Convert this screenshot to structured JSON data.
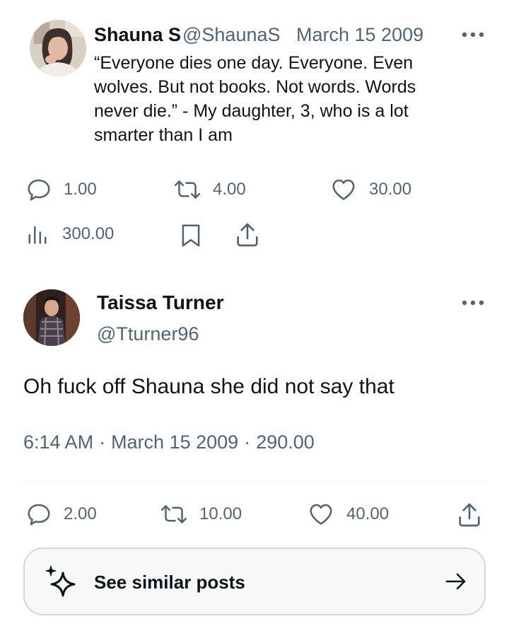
{
  "tweet1": {
    "author_name": "Shauna S",
    "author_handle": "@ShaunaS",
    "date": "March 15 2009",
    "text": "“Everyone dies one day. Everyone. Even wolves. But not books. Not words. Words never die.” - My daughter, 3, who is a lot smarter than I am",
    "replies": "1.00",
    "retweets": "4.00",
    "likes": "30.00",
    "views": "300.00",
    "icons": [
      "avatar",
      "more-icon",
      "reply-icon",
      "retweet-icon",
      "like-icon",
      "views-icon",
      "bookmark-icon",
      "share-icon"
    ]
  },
  "tweet2": {
    "author_name": "Taissa Turner",
    "author_handle": "@Tturner96",
    "text": "Oh fuck off Shauna she did not say that",
    "time": "6:14 AM",
    "date": "March 15 2009",
    "views": "290.00",
    "separator": "·",
    "replies": "2.00",
    "retweets": "10.00",
    "likes": "40.00",
    "icons": [
      "avatar",
      "more-icon",
      "reply-icon",
      "retweet-icon",
      "like-icon",
      "share-icon"
    ]
  },
  "similar_posts": {
    "label": "See similar posts",
    "icons": [
      "sparkle-icon",
      "arrow-right-icon"
    ]
  },
  "colors": {
    "text": "#0f1419",
    "secondary": "#536471",
    "divider": "#eff3f4",
    "card_border": "#cfd9de",
    "card_bg": "#f7f9f9"
  }
}
